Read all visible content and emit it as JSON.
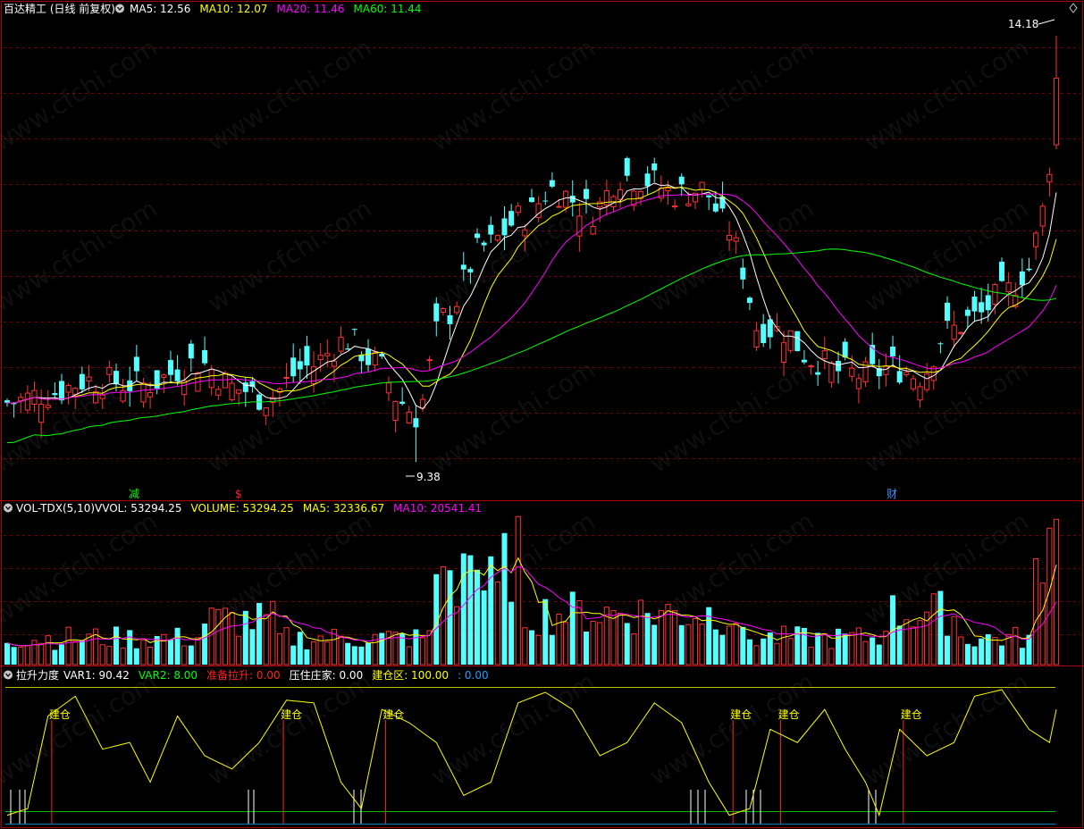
{
  "main_panel": {
    "title": "百达精工 (日线 前复权)",
    "indicators": [
      {
        "name": "MA5",
        "value": "12.56",
        "color": "#ffffff"
      },
      {
        "name": "MA10",
        "value": "12.07",
        "color": "#ffff00"
      },
      {
        "name": "MA20",
        "value": "11.46",
        "color": "#ff00ff"
      },
      {
        "name": "MA60",
        "value": "11.44",
        "color": "#00ff00"
      }
    ],
    "high_label": "14.18",
    "low_label": "9.38",
    "markers": [
      {
        "text": "减",
        "color": "#00ff00"
      },
      {
        "text": "$",
        "color": "#ff2020"
      },
      {
        "text": "财",
        "color": "#4090ff"
      }
    ]
  },
  "volume_panel": {
    "title": "VOL-TDX(5,10)",
    "indicators": [
      {
        "name": "VVOL",
        "value": "53294.25",
        "color": "#ffffff"
      },
      {
        "name": "VOLUME",
        "value": "53294.25",
        "color": "#ffff00"
      },
      {
        "name": "MA5",
        "value": "32336.67",
        "color": "#ffff00"
      },
      {
        "name": "MA10",
        "value": "20541.41",
        "color": "#ff00ff"
      }
    ]
  },
  "indicator_panel": {
    "title": "拉升力度",
    "indicators": [
      {
        "name": "VAR1",
        "value": "90.42",
        "color": "#ffffff"
      },
      {
        "name": "VAR2",
        "value": "8.00",
        "color": "#00ff00"
      },
      {
        "name": "准备拉升",
        "value": "0.00",
        "color": "#ff2020"
      },
      {
        "name": "压住庄家",
        "value": "0.00",
        "color": "#ffffff"
      },
      {
        "name": "建仓区",
        "value": "100.00",
        "color": "#ffff00"
      },
      {
        "name": "",
        "value": "0.00",
        "color": "#20a0ff"
      }
    ],
    "signal_label": "建仓"
  },
  "watermark": "www.cfchi.com",
  "colors": {
    "up": "#ff3232",
    "down": "#54ffff",
    "grid": "#7a0000",
    "border": "#b00000",
    "ma5": "#ffffff",
    "ma10": "#ffff00",
    "ma20": "#ff00ff",
    "ma60": "#00ff00"
  }
}
